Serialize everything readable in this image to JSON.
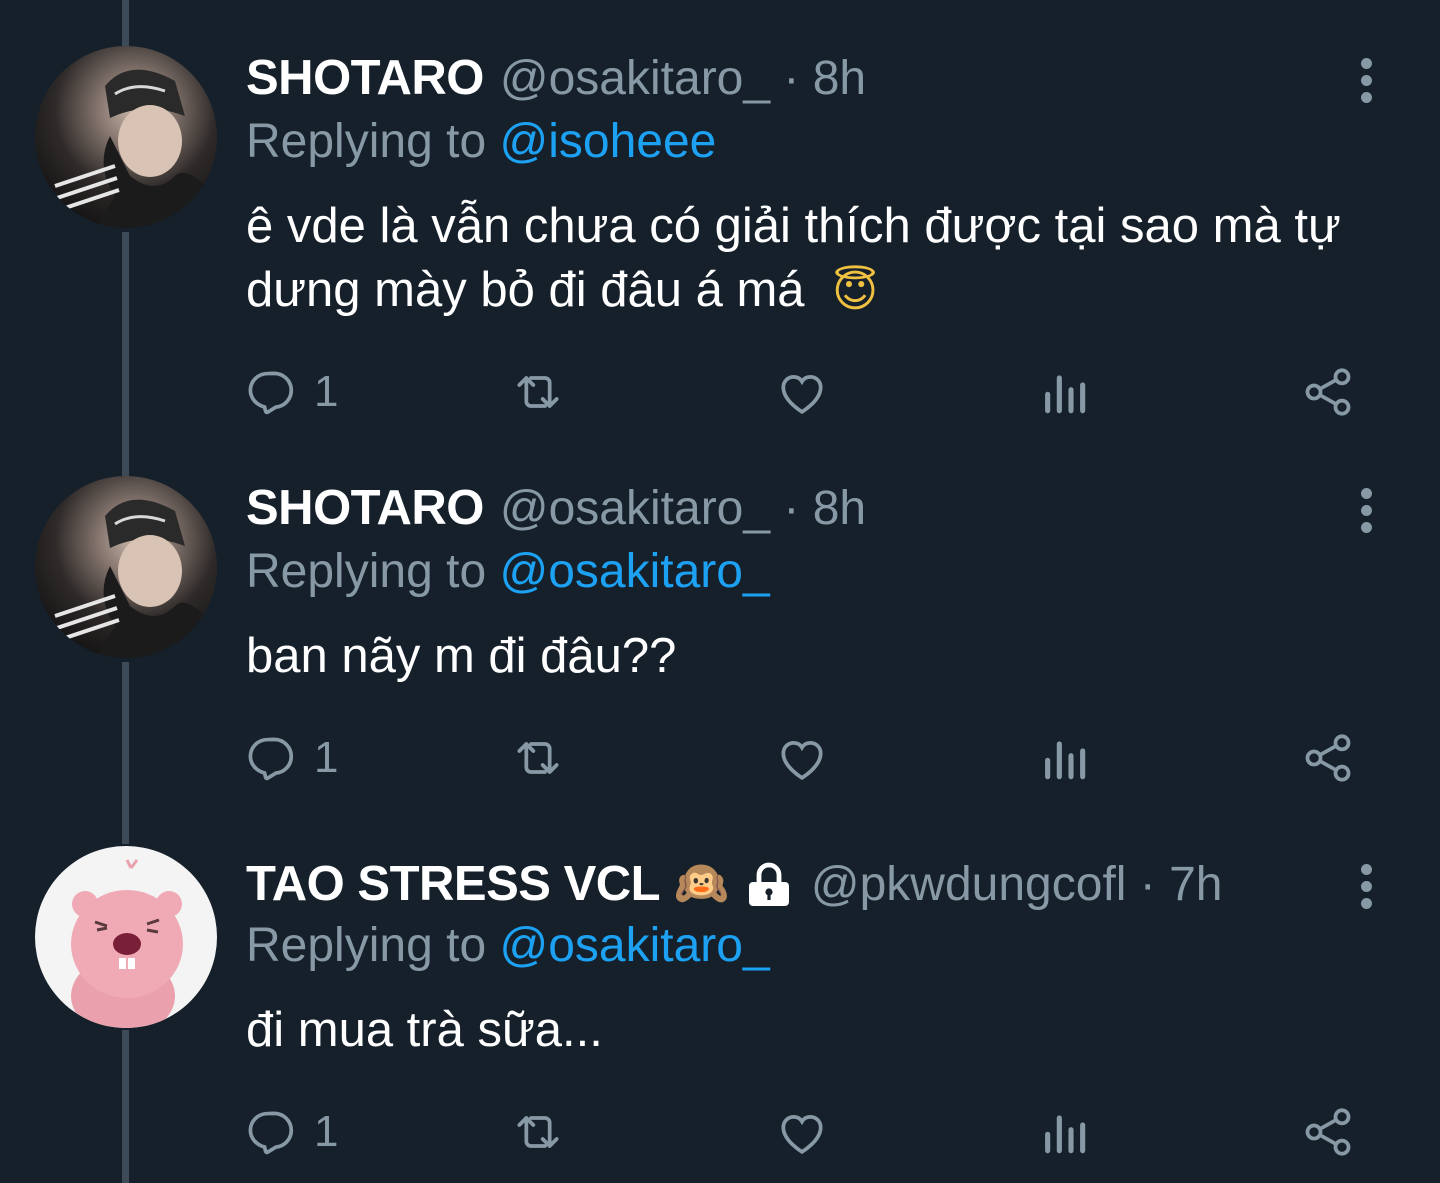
{
  "tweets": [
    {
      "name": "SHOTARO",
      "handle_time": "@osakitaro_ · 8h",
      "replying_prefix": "Replying to",
      "replying_to": "@isoheee",
      "text": "ê vde là vẫn chưa có giải thích được tại sao mà tự dưng mày bỏ đi đâu á má",
      "text_emoji": "😇",
      "reply_count": "1"
    },
    {
      "name": "SHOTARO",
      "handle_time": "@osakitaro_ · 8h",
      "replying_prefix": "Replying to",
      "replying_to": "@osakitaro_",
      "text": "ban nãy m đi đâu??",
      "reply_count": "1"
    },
    {
      "name": "TAO STRESS VCL",
      "name_emoji": "🙉",
      "handle_time": "@pkwdungcofl · 7h",
      "replying_prefix": "Replying to",
      "replying_to": "@osakitaro_",
      "text": "đi mua trà sữa...",
      "reply_count": "1"
    }
  ],
  "icons": {
    "reply": "reply-icon",
    "retweet": "retweet-icon",
    "like": "heart-icon",
    "analytics": "analytics-icon",
    "share": "share-icon",
    "more": "more-vertical-icon",
    "lock": "lock-icon"
  },
  "colors": {
    "background": "#15202b",
    "text": "#ffffff",
    "muted": "#8899a6",
    "link": "#1da1f2",
    "thread_line": "#3d4a57"
  }
}
